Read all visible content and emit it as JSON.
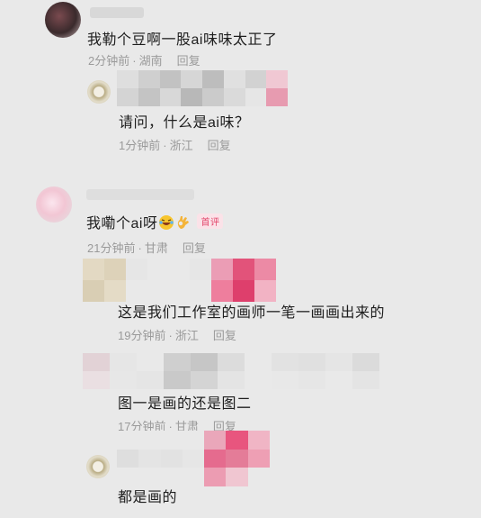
{
  "comments": [
    {
      "id": "c1",
      "text": "我勒个豆啊一股ai味味太正了",
      "time": "2分钟前",
      "location": "湖南",
      "reply_label": "回复",
      "replies": [
        {
          "id": "r1",
          "text": "请问，什么是ai味？",
          "time": "1分钟前",
          "location": "浙江",
          "reply_label": "回复"
        }
      ]
    },
    {
      "id": "c2",
      "text": "我嘞个ai呀",
      "emojis": [
        "laughing-crying-emoji",
        "ok-hand-emoji"
      ],
      "badge": "首评",
      "time": "21分钟前",
      "location": "甘肃",
      "reply_label": "回复",
      "replies": [
        {
          "id": "r2",
          "text": "这是我们工作室的画师一笔一画画出来的",
          "time": "19分钟前",
          "location": "浙江",
          "reply_label": "回复"
        },
        {
          "id": "r3",
          "text": "图一是画的还是图二",
          "time": "17分钟前",
          "location": "甘肃",
          "reply_label": "回复"
        },
        {
          "id": "r4",
          "text": "都是画的"
        }
      ]
    }
  ],
  "colors": {
    "background": "#e9e9e9",
    "text": "#1e1e1e",
    "meta": "#9a9a9a",
    "badge": "#e2456a",
    "mosaic_pink": "#e8557e"
  }
}
